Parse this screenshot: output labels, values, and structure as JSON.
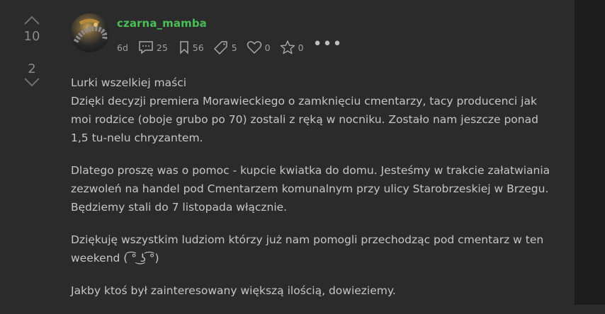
{
  "votes": {
    "up_count": "10",
    "down_count": "2"
  },
  "author": {
    "username": "czarna_mamba"
  },
  "meta": {
    "time": "6d",
    "comments": "25",
    "bookmarks": "56",
    "tags": "5",
    "likes": "0",
    "favorites": "0"
  },
  "post": {
    "title": "Lurki wszelkiej maści",
    "paragraphs": [
      "Dzięki decyzji premiera Morawieckiego o zamknięciu cmentarzy, tacy producenci jak moi rodzice (oboje grubo po 70) zostali z ręką w nocniku. Zostało nam jeszcze ponad 1,5 tu-nelu chryzantem.",
      "Dlatego proszę was o pomoc - kupcie kwiatka do domu. Jesteśmy w trakcie załatwiania zezwoleń na handel pod Cmentarzem komunalnym przy ulicy Starobrzeskiej w Brzegu. Będziemy stali do 7 listopada włącznie.",
      "Dziękuję wszystkim ludziom którzy już nam pomogli przechodząc pod cmentarz w ten weekend ( ͡° ͜ʖ ͡°)",
      "Jakby ktoś był zainteresowany większą ilością, dowieziemy."
    ]
  }
}
